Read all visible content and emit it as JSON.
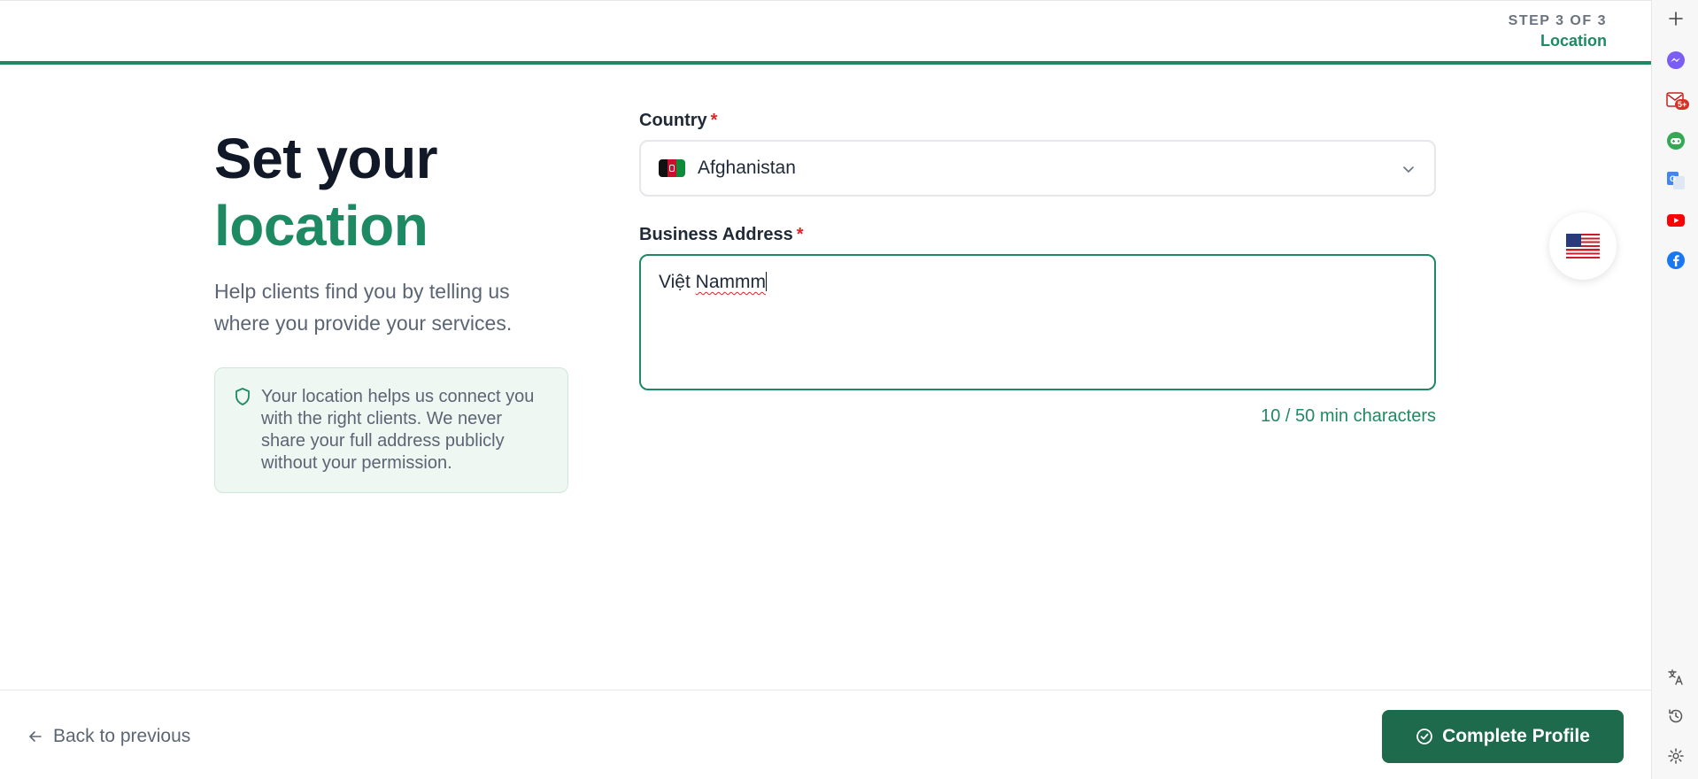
{
  "step": {
    "count": "STEP 3 OF 3",
    "name": "Location"
  },
  "intro": {
    "heading_line1": "Set your",
    "heading_line2": "location",
    "subtext": "Help clients find you by telling us where you provide your services.",
    "info": "Your location helps us connect you with the right clients. We never share your full address publicly without your permission."
  },
  "country": {
    "label": "Country",
    "required_mark": "*",
    "value": "Afghanistan"
  },
  "address": {
    "label": "Business Address",
    "required_mark": "*",
    "value_word1": "Việt",
    "value_word2": "Nammm",
    "char_count": "10 / 50 min characters"
  },
  "footer": {
    "back_label": "Back to previous",
    "complete_label": "Complete Profile"
  },
  "colors": {
    "accent": "#1e8a63",
    "button": "#1e6a4d",
    "required": "#dc2626"
  },
  "sidebar_icons": [
    "plus-icon",
    "messenger-icon",
    "mail-badge-icon",
    "gamepad-icon",
    "google-translate-icon",
    "youtube-icon",
    "facebook-icon",
    "translate-icon",
    "history-icon",
    "settings-icon"
  ],
  "mail_badge": "5+"
}
